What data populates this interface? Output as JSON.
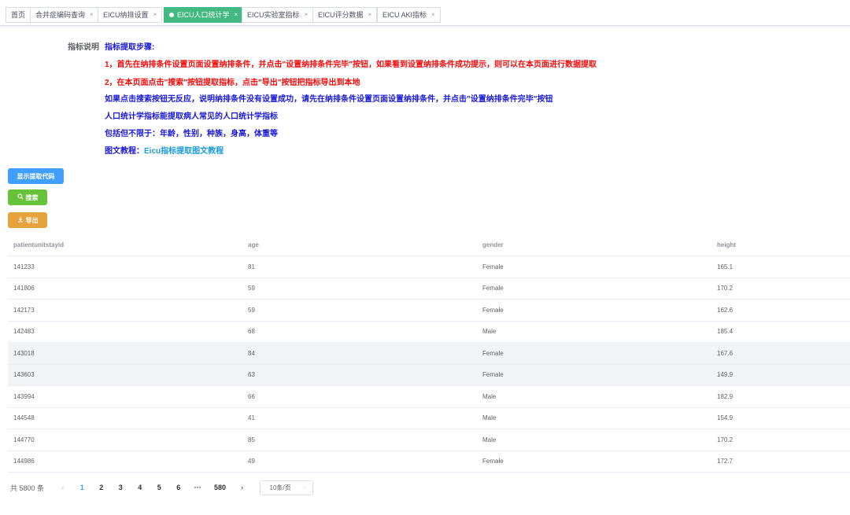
{
  "tabs": [
    {
      "label": "首页",
      "closable": false,
      "active": false
    },
    {
      "label": "合并症编码查询",
      "closable": true,
      "active": false
    },
    {
      "label": "EICU纳排设置",
      "closable": true,
      "active": false
    },
    {
      "label": "EICU人口统计学",
      "closable": true,
      "active": true
    },
    {
      "label": "EICU实验室指标",
      "closable": true,
      "active": false
    },
    {
      "label": "EICU评分数据",
      "closable": true,
      "active": false
    },
    {
      "label": "EICU AKI指标",
      "closable": true,
      "active": false
    }
  ],
  "tab_close_glyph": "×",
  "instructions": {
    "label": "指标说明",
    "heading": "指标提取步骤:",
    "step1": "1，首先在纳排条件设置页面设置纳排条件，并点击\"设置纳排条件完毕\"按钮，如果看到设置纳排条件成功提示，则可以在本页面进行数据提取",
    "step2": "2，在本页面点击\"搜索\"按钮提取指标，点击\"导出\"按钮把指标导出到本地",
    "note1": "如果点击搜索按钮无反应，说明纳排条件没有设置成功，请先在纳排条件设置页面设置纳排条件，并点击\"设置纳排条件完毕\"按钮",
    "note2": "人口统计学指标能提取病人常见的人口统计学指标",
    "note3": "包括但不限于：年龄，性别，种族，身高，体重等",
    "tutorial_prefix": "图文教程：",
    "tutorial_link": "Eicu指标提取图文教程"
  },
  "buttons": {
    "show_code": "显示提取代码",
    "search": "搜索",
    "export": "导出"
  },
  "table": {
    "columns": [
      "patientunitstayid",
      "age",
      "gender",
      "height"
    ],
    "rows": [
      [
        "141233",
        "81",
        "Female",
        "165.1"
      ],
      [
        "141806",
        "59",
        "Female",
        "170.2"
      ],
      [
        "142173",
        "59",
        "Female",
        "162.6"
      ],
      [
        "142483",
        "68",
        "Male",
        "185.4"
      ],
      [
        "143018",
        "84",
        "Female",
        "167.6"
      ],
      [
        "143603",
        "63",
        "Female",
        "149.9"
      ],
      [
        "143994",
        "66",
        "Male",
        "182.9"
      ],
      [
        "144548",
        "41",
        "Male",
        "154.9"
      ],
      [
        "144770",
        "85",
        "Male",
        "170.2"
      ],
      [
        "144986",
        "49",
        "Female",
        "172.7"
      ]
    ],
    "highlighted_rows": [
      4,
      5
    ]
  },
  "pagination": {
    "total": "共 5800 条",
    "prev": "‹",
    "pages": [
      "1",
      "2",
      "3",
      "4",
      "5",
      "6"
    ],
    "current": "1",
    "ellipsis": "···",
    "last": "580",
    "next": "›",
    "page_size": "10条/页",
    "page_size_chevron": "⌵"
  },
  "colors": {
    "active_tab": "#42b983",
    "primary": "#409eff",
    "success": "#67c23a",
    "warning": "#e6a23c",
    "instr_blue": "#1818d6",
    "instr_red": "#f50a0a",
    "link": "#1a9ad8"
  },
  "icons": {
    "search_button_icon": "search-icon",
    "export_button_icon": "download-icon"
  }
}
